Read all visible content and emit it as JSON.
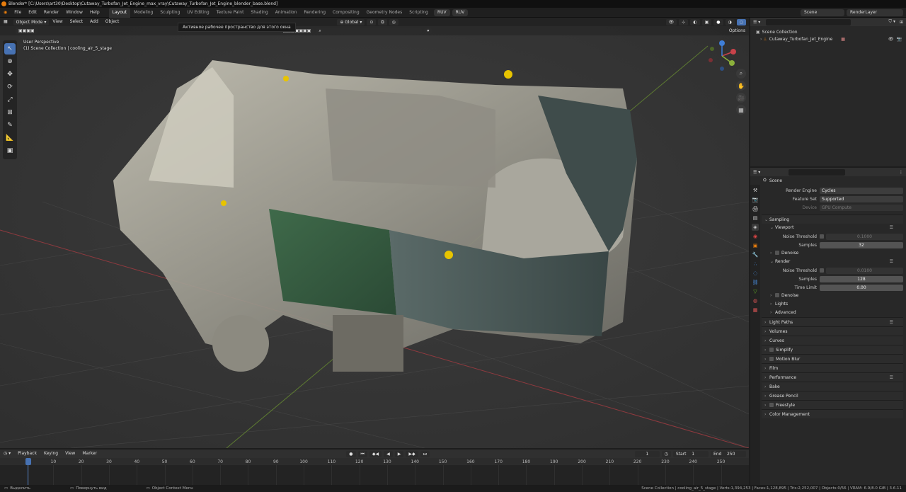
{
  "window": {
    "title": "Blender* [C:\\Users\\art30\\Desktop\\Cutaway_Turbofan_Jet_Engine_max_vray\\Cutaway_Turbofan_Jet_Engine_blender_base.blend]"
  },
  "menubar": {
    "menus": [
      "File",
      "Edit",
      "Render",
      "Window",
      "Help"
    ],
    "workspaces": [
      "Layout",
      "Modeling",
      "Sculpting",
      "UV Editing",
      "Texture Paint",
      "Shading",
      "Animation",
      "Rendering",
      "Compositing",
      "Geometry Nodes",
      "Scripting"
    ],
    "active_workspace": "Layout",
    "extra_buttons": [
      "RUV",
      "RUV"
    ],
    "scene": "Scene",
    "view_layer": "RenderLayer"
  },
  "viewport": {
    "mode": "Object Mode",
    "menus": [
      "View",
      "Select",
      "Add",
      "Object"
    ],
    "transform_orientation": "Global",
    "options_label": "Options",
    "tooltip": "Активное рабочее пространство для этого окна",
    "overlay_line1": "User Perspective",
    "overlay_line2": "(1) Scene Collection | cooling_air_5_stage"
  },
  "outliner": {
    "collection": "Scene Collection",
    "items": [
      "Cutaway_Turbofan_Jet_Engine"
    ]
  },
  "properties": {
    "context": "Scene",
    "render_engine_label": "Render Engine",
    "render_engine": "Cycles",
    "feature_set_label": "Feature Set",
    "feature_set": "Supported",
    "device_label": "Device",
    "device": "GPU Compute",
    "sampling": "Sampling",
    "viewport": "Viewport",
    "noise_threshold_label": "Noise Threshold",
    "viewport_noise": "0.1000",
    "samples_label": "Samples",
    "viewport_samples": "32",
    "denoise": "Denoise",
    "render": "Render",
    "render_noise": "0.0100",
    "render_samples": "128",
    "time_limit_label": "Time Limit",
    "time_limit": "0.00",
    "lights": "Lights",
    "advanced": "Advanced",
    "sections": [
      "Light Paths",
      "Volumes",
      "Curves",
      "Simplify",
      "Motion Blur",
      "Film",
      "Performance",
      "Bake",
      "Grease Pencil",
      "Freestyle",
      "Color Management"
    ]
  },
  "timeline": {
    "menus": [
      "Playback",
      "Keying",
      "View",
      "Marker"
    ],
    "current_frame": "1",
    "start_label": "Start",
    "start": "1",
    "end_label": "End",
    "end": "250",
    "ticks": [
      "1",
      "10",
      "20",
      "30",
      "40",
      "50",
      "60",
      "70",
      "80",
      "90",
      "100",
      "110",
      "120",
      "130",
      "140",
      "150",
      "160",
      "170",
      "180",
      "190",
      "200",
      "210",
      "220",
      "230",
      "240",
      "250"
    ]
  },
  "statusbar": {
    "left1": "Выделить",
    "left2": "Повернуть вид",
    "left3": "Object Context Menu",
    "right": "Scene Collection | cooling_air_5_stage | Verts:1,394,253 | Faces:1,128,895 | Tris:2,252,007 | Objects:0/56 | VRAM: 6.9/8.0 GiB | 3.6.11"
  },
  "colors": {
    "accent": "#4772b3",
    "blender_orange": "#e87d0d",
    "x_axis": "#c8424a",
    "y_axis": "#8bb03b",
    "z_axis": "#3f7fd8"
  }
}
